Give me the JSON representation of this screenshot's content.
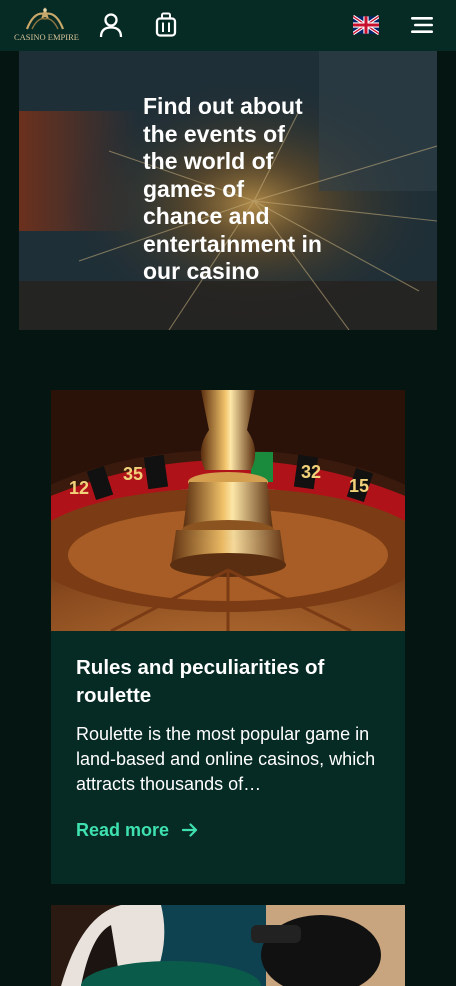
{
  "header": {
    "logo_text": "CASINO EMPIRE",
    "icons": [
      "user-icon",
      "luggage-icon",
      "uk-flag-icon",
      "hamburger-menu-icon"
    ]
  },
  "hero": {
    "title": "Find out about the events of the world of games of chance and entertainment in our casino"
  },
  "articles": [
    {
      "title": "Rules and peculiarities of roulette",
      "excerpt": "Roulette is the most popular game in land-based and online casinos, which attracts thousands of…",
      "read_more": "Read more",
      "image_alt": "roulette-wheel-image"
    }
  ],
  "colors": {
    "background": "#051612",
    "header": "#062a24",
    "card": "#062a24",
    "accent": "#3ee0ae",
    "logo_gold": "#d8c59b"
  }
}
